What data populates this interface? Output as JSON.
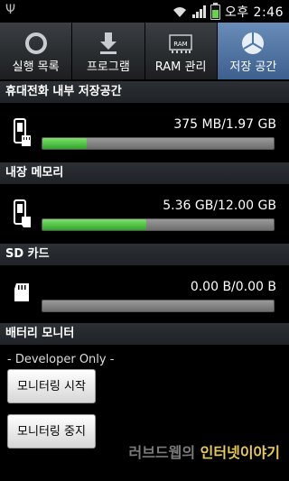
{
  "status_bar": {
    "usb_icon": "usb-icon",
    "wifi_icon": "wifi-icon",
    "signal_icon": "signal-icon",
    "battery_icon": "battery-charging-icon",
    "time": "오후 2:46"
  },
  "tabs": [
    {
      "label": "실행 목록",
      "icon": "running-list-icon",
      "active": false
    },
    {
      "label": "프로그램",
      "icon": "download-icon",
      "active": false
    },
    {
      "label": "RAM 관리",
      "icon": "ram-chip-icon",
      "active": false
    },
    {
      "label": "저장 공간",
      "icon": "pie-chart-icon",
      "active": true
    }
  ],
  "sections": {
    "phone_storage": {
      "title": "휴대전화 내부 저장공간",
      "amount": "375 MB/1.97 GB",
      "used_fraction": 0.19
    },
    "internal_memory": {
      "title": "내장 메모리",
      "amount": "5.36 GB/12.00 GB",
      "used_fraction": 0.45
    },
    "sd_card": {
      "title": "SD 카드",
      "amount": "0.00 B/0.00 B",
      "used_fraction": 0
    },
    "battery_monitor": {
      "title": "배터리 모니터",
      "developer_note": "- Developer Only -",
      "start_button": "모니터링 시작",
      "stop_button": "모니터링 중지"
    }
  },
  "watermark": {
    "prefix": "러브드웹의",
    "highlight": "인터넷이야기"
  },
  "colors": {
    "accent_tab": "#4f74a6",
    "bar_fill": "#3cb83a",
    "bar_track": "#8a8a8a"
  }
}
